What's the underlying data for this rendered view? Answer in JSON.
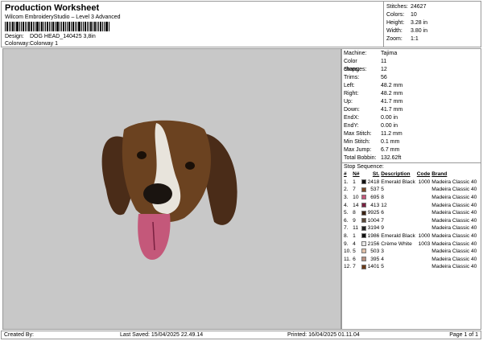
{
  "header": {
    "title": "Production Worksheet",
    "software": "Wilcom EmbroideryStudio – Level 3 Advanced",
    "design_label": "Design:",
    "design": "DOG HEAD_140425 3,8in",
    "colorway_label": "Colorway:",
    "colorway": "Colorway 1"
  },
  "summary": [
    {
      "label": "Stitches:",
      "value": "24627"
    },
    {
      "label": "Colors:",
      "value": "10"
    },
    {
      "label": "Height:",
      "value": "3.28 in"
    },
    {
      "label": "Width:",
      "value": "3.80 in"
    },
    {
      "label": "Zoom:",
      "value": "1:1"
    }
  ],
  "machine": [
    {
      "label": "Machine:",
      "value": "Tajima"
    },
    {
      "label": "Color changes:",
      "value": "11"
    },
    {
      "label": "Stops:",
      "value": "12"
    },
    {
      "label": "Trims:",
      "value": "56"
    },
    {
      "label": "Left:",
      "value": "48.2 mm"
    },
    {
      "label": "Right:",
      "value": "48.2 mm"
    },
    {
      "label": "Up:",
      "value": "41.7 mm"
    },
    {
      "label": "Down:",
      "value": "41.7 mm"
    },
    {
      "label": "EndX:",
      "value": "0.00 in"
    },
    {
      "label": "EndY:",
      "value": "0.00 in"
    },
    {
      "label": "Max Stitch:",
      "value": "11.2 mm"
    },
    {
      "label": "Min Stitch:",
      "value": "0.1 mm"
    },
    {
      "label": "Max Jump:",
      "value": "6.7 mm"
    },
    {
      "label": "Total Bobbin:",
      "value": "132.62ft"
    }
  ],
  "stop_sequence": {
    "title": "Stop Sequence:",
    "columns": [
      "#",
      "N#",
      "St.",
      "Description",
      "Code",
      "Brand"
    ],
    "rows": [
      {
        "n": "1.",
        "num": "1",
        "color": "#111111",
        "st": "2418",
        "desc": "Emerald Black",
        "code": "1000",
        "brand": "Madeira Classic 40"
      },
      {
        "n": "2.",
        "num": "7",
        "color": "#7a4a2a",
        "st": "537",
        "desc": "5",
        "code": "",
        "brand": "Madeira Classic 40"
      },
      {
        "n": "3.",
        "num": "10",
        "color": "#c4587a",
        "st": "695",
        "desc": "8",
        "code": "",
        "brand": "Madeira Classic 40"
      },
      {
        "n": "4.",
        "num": "14",
        "color": "#7a2040",
        "st": "413",
        "desc": "12",
        "code": "",
        "brand": "Madeira Classic 40"
      },
      {
        "n": "5.",
        "num": "8",
        "color": "#3a2212",
        "st": "9925",
        "desc": "6",
        "code": "",
        "brand": "Madeira Classic 40"
      },
      {
        "n": "6.",
        "num": "9",
        "color": "#5a4838",
        "st": "1004",
        "desc": "7",
        "code": "",
        "brand": "Madeira Classic 40"
      },
      {
        "n": "7.",
        "num": "11",
        "color": "#222222",
        "st": "3194",
        "desc": "9",
        "code": "",
        "brand": "Madeira Classic 40"
      },
      {
        "n": "8.",
        "num": "1",
        "color": "#111111",
        "st": "1986",
        "desc": "Emerald Black",
        "code": "1000",
        "brand": "Madeira Classic 40"
      },
      {
        "n": "9.",
        "num": "4",
        "color": "#e8e8e8",
        "st": "2156",
        "desc": "Crème White",
        "code": "1003",
        "brand": "Madeira Classic 40"
      },
      {
        "n": "10.",
        "num": "5",
        "color": "#e0c0a8",
        "st": "503",
        "desc": "3",
        "code": "",
        "brand": "Madeira Classic 40"
      },
      {
        "n": "11.",
        "num": "6",
        "color": "#b89080",
        "st": "395",
        "desc": "4",
        "code": "",
        "brand": "Madeira Classic 40"
      },
      {
        "n": "12.",
        "num": "7",
        "color": "#6a3a18",
        "st": "1401",
        "desc": "5",
        "code": "",
        "brand": "Madeira Classic 40"
      }
    ]
  },
  "footer": {
    "created": "Created By:",
    "saved": "Last Saved: 15/04/2025 22.49.14",
    "printed": "Printed: 16/04/2025 01.11.04",
    "page": "Page 1 of 1"
  }
}
